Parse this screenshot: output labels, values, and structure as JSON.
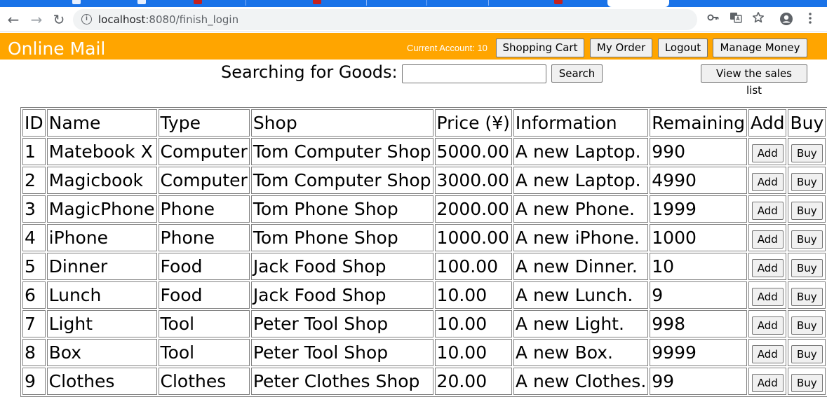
{
  "browser": {
    "url_host": "localhost",
    "url_port_path": ":8080/finish_login",
    "back_glyph": "←",
    "forward_glyph": "→",
    "reload_glyph": "↻",
    "icons": [
      "info-icon",
      "key-icon",
      "translate-icon",
      "star-icon",
      "profile-icon",
      "menu-icon"
    ]
  },
  "header": {
    "title": "Online Mail",
    "account": "Current Account: 10",
    "buttons": {
      "cart": "Shopping Cart",
      "order": "My Order",
      "logout": "Logout",
      "money": "Manage Money"
    },
    "color": "#ffa500"
  },
  "search": {
    "label": "Searching for Goods:",
    "value": "",
    "button": "Search",
    "sales_button": "View the sales list"
  },
  "table": {
    "headers": [
      "ID",
      "Name",
      "Type",
      "Shop",
      "Price (¥)",
      "Information",
      "Remaining",
      "Add",
      "Buy"
    ],
    "add_label": "Add",
    "buy_label": "Buy",
    "rows": [
      [
        "1",
        "Matebook X",
        "Computer",
        "Tom Computer Shop",
        "5000.00",
        "A new Laptop.",
        "990"
      ],
      [
        "2",
        "Magicbook",
        "Computer",
        "Tom Computer Shop",
        "3000.00",
        "A new Laptop.",
        "4990"
      ],
      [
        "3",
        "MagicPhone",
        "Phone",
        "Tom Phone Shop",
        "2000.00",
        "A new Phone.",
        "1999"
      ],
      [
        "4",
        "iPhone",
        "Phone",
        "Tom Phone Shop",
        "1000.00",
        "A new iPhone.",
        "1000"
      ],
      [
        "5",
        "Dinner",
        "Food",
        "Jack Food Shop",
        "100.00",
        "A new Dinner.",
        "10"
      ],
      [
        "6",
        "Lunch",
        "Food",
        "Jack Food Shop",
        "10.00",
        "A new Lunch.",
        "9"
      ],
      [
        "7",
        "Light",
        "Tool",
        "Peter Tool Shop",
        "10.00",
        "A new Light.",
        "998"
      ],
      [
        "8",
        "Box",
        "Tool",
        "Peter Tool Shop",
        "10.00",
        "A new Box.",
        "9999"
      ],
      [
        "9",
        "Clothes",
        "Clothes",
        "Peter Clothes Shop",
        "20.00",
        "A new Clothes.",
        "99"
      ]
    ]
  }
}
